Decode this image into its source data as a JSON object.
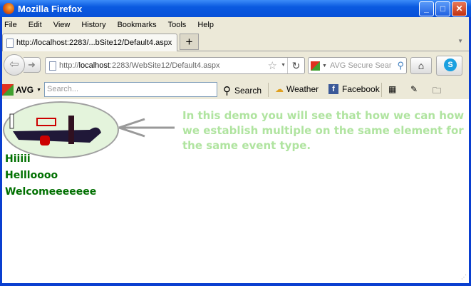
{
  "window": {
    "title": "Mozilla Firefox"
  },
  "menu": [
    "File",
    "Edit",
    "View",
    "History",
    "Bookmarks",
    "Tools",
    "Help"
  ],
  "tab": {
    "title": "http://localhost:2283/...bSite12/Default4.aspx"
  },
  "url": {
    "prefix": "http://",
    "host": "localhost",
    "rest": ":2283/WebSite12/Default4.aspx"
  },
  "search": {
    "placeholder": "AVG Secure Sear"
  },
  "avg": {
    "logo": "AVG",
    "search_placeholder": "Search...",
    "search_label": "Search",
    "weather_label": "Weather",
    "facebook_label": "Facebook"
  },
  "content": {
    "message": "In this demo you will see that how we can how we establish multiple on the same element for the same event type.",
    "lines": [
      "Hiiiii",
      "Hellloooo",
      "Welcomeeeeeee"
    ]
  }
}
